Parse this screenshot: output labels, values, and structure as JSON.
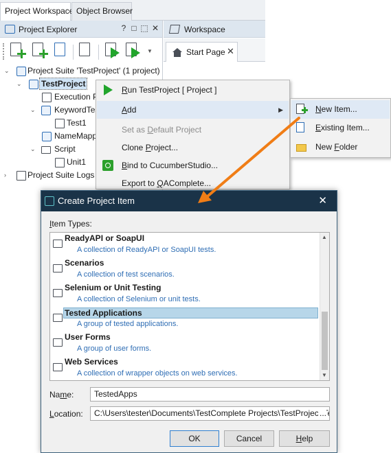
{
  "top_tabs": [
    "Project Workspace",
    "Object Browser"
  ],
  "project_explorer": {
    "title": "Project Explorer",
    "controls": [
      "?",
      "□",
      "⬚",
      "✕"
    ]
  },
  "workspace": {
    "title": "Workspace",
    "tab": "Start Page",
    "tab_close": "✕"
  },
  "tree": [
    {
      "label": "Project Suite 'TestProject' (1 project)"
    },
    {
      "label": "TestProject"
    },
    {
      "label": "Execution Pla"
    },
    {
      "label": "KeywordTest"
    },
    {
      "label": "Test1"
    },
    {
      "label": "NameMappin"
    },
    {
      "label": "Script"
    },
    {
      "label": "Unit1"
    },
    {
      "label": "Project Suite Logs"
    }
  ],
  "context_menu": {
    "run": {
      "pre": "",
      "ul": "R",
      "post": "un TestProject  [ Project ]"
    },
    "add": {
      "pre": "",
      "ul": "A",
      "post": "dd"
    },
    "set_default": {
      "pre": "Set as ",
      "ul": "D",
      "post": "efault Project"
    },
    "clone": {
      "pre": "Clone ",
      "ul": "P",
      "post": "roject..."
    },
    "bind": {
      "pre": "",
      "ul": "B",
      "post": "ind to CucumberStudio..."
    },
    "export": {
      "pre": "Export to ",
      "ul": "Q",
      "post": "AComplete..."
    }
  },
  "submenu": {
    "new_item": {
      "pre": "",
      "ul": "N",
      "post": "ew Item..."
    },
    "existing_item": {
      "pre": "",
      "ul": "E",
      "post": "xisting Item..."
    },
    "new_folder": {
      "pre": "New ",
      "ul": "F",
      "post": "older"
    }
  },
  "dialog": {
    "title": "Create Project Item",
    "close": "✕",
    "item_types_label": {
      "pre": "",
      "ul": "I",
      "post": "tem Types:"
    },
    "items": [
      {
        "title": "ReadyAPI or SoapUI",
        "desc": "A collection of ReadyAPI or SoapUI tests."
      },
      {
        "title": "Scenarios",
        "desc": "A collection of test scenarios."
      },
      {
        "title": "Selenium or Unit Testing",
        "desc": "A collection of Selenium or unit tests."
      },
      {
        "title": "Tested Applications",
        "desc": "A group of tested applications."
      },
      {
        "title": "User Forms",
        "desc": "A group of user forms."
      },
      {
        "title": "Web Services",
        "desc": "A collection of wrapper objects on web services."
      }
    ],
    "name_label": {
      "pre": "Na",
      "ul": "m",
      "post": "e:"
    },
    "name_value": "TestedApps",
    "location_label": {
      "pre": "",
      "ul": "L",
      "post": "ocation:"
    },
    "location_value": "C:\\Users\\tester\\Documents\\TestComplete Projects\\TestProject\\Test",
    "location_browse": "...",
    "ok": "OK",
    "cancel": "Cancel",
    "help": {
      "pre": "",
      "ul": "H",
      "post": "elp"
    }
  },
  "colors": {
    "accent_arrow": "#f07d16",
    "dialog_titlebar": "#1a3348",
    "link_blue": "#2e6db4",
    "selection": "#b7d6e9"
  }
}
